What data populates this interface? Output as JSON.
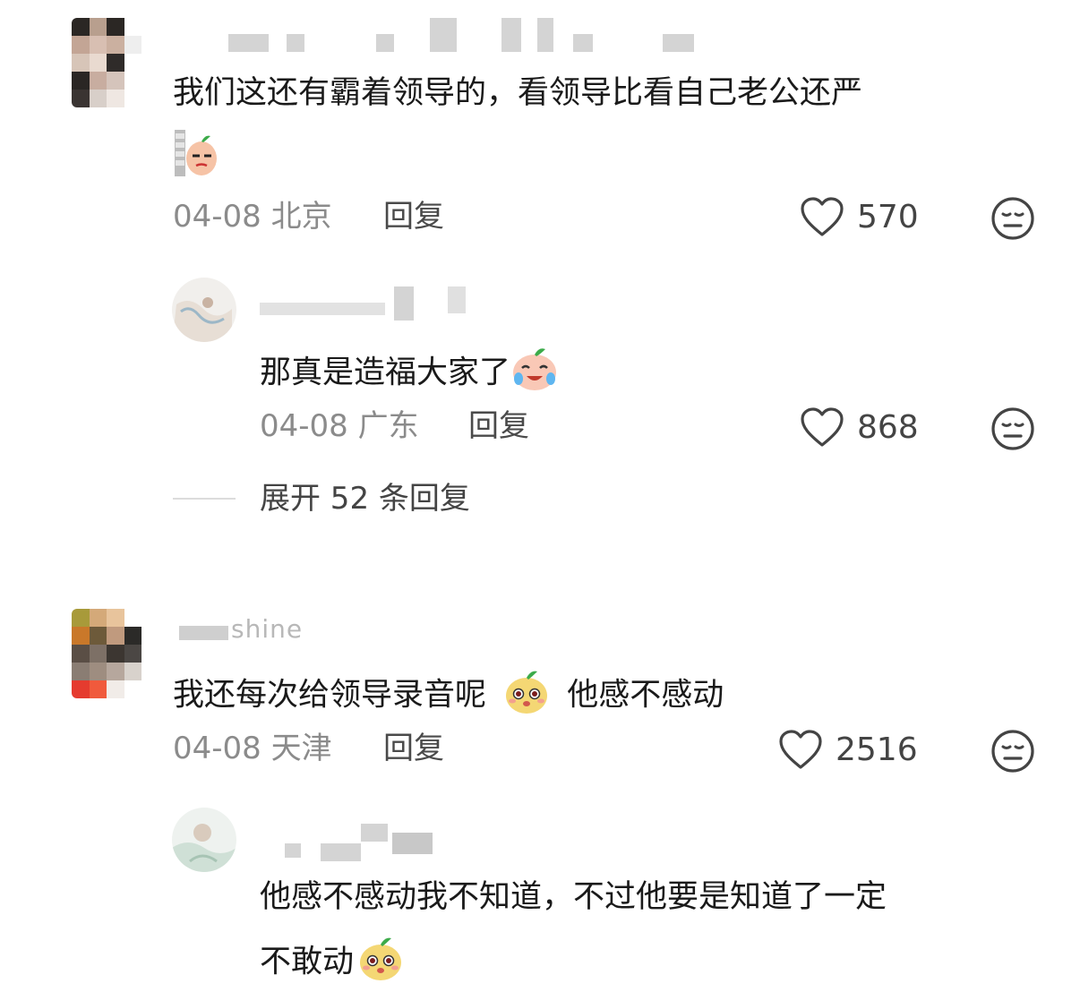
{
  "comments": [
    {
      "username": "",
      "text": "我们这还有霸着领导的，看领导比看自己老公还严",
      "sticker_icon": "peach-wall-smirk-sticker-icon",
      "date": "04-08",
      "location": "北京",
      "reply_label": "回复",
      "like_count": "570",
      "reply": {
        "username": "",
        "text": "那真是造福大家了",
        "emoji_icon": "crying-laughing-peach-icon",
        "date": "04-08",
        "location": "广东",
        "reply_label": "回复",
        "like_count": "868"
      },
      "expand_label": "展开 52 条回复"
    },
    {
      "username": "shine",
      "text_before": "我还每次给领导录音呢",
      "emoji_icon": "peach-surprised-icon",
      "text_after": "他感不感动",
      "date": "04-08",
      "location": "天津",
      "reply_label": "回复",
      "like_count": "2516",
      "reply": {
        "username": "",
        "text_line1": "他感不感动我不知道，不过他要是知道了一定",
        "text_line2": "不敢动",
        "emoji_icon": "peach-surprised-icon"
      }
    }
  ],
  "colors": {
    "text": "#1a1a1a",
    "meta": "#8b8b8b",
    "icon": "#444444"
  }
}
